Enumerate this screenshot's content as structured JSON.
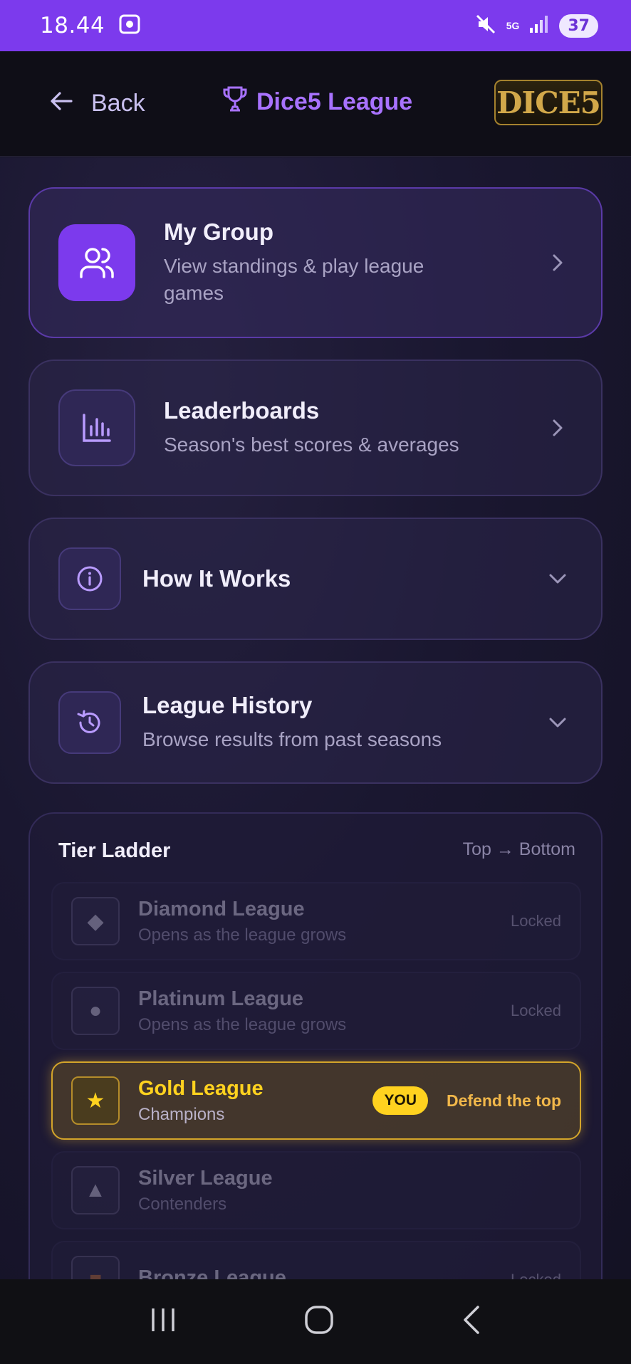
{
  "status_bar": {
    "time": "18.44",
    "network": "5G",
    "battery": "37",
    "icons": [
      "screenshot-icon",
      "mute-icon",
      "signal-icon"
    ]
  },
  "header": {
    "back_label": "Back",
    "title": "Dice5 League",
    "logo_text": "DICE5"
  },
  "menu": {
    "my_group": {
      "title": "My Group",
      "subtitle": "View standings & play league games"
    },
    "leaderboards": {
      "title": "Leaderboards",
      "subtitle": "Season's best scores & averages"
    },
    "how_it_works": {
      "title": "How It Works"
    },
    "league_history": {
      "title": "League History",
      "subtitle": "Browse results from past seasons"
    }
  },
  "tier_ladder": {
    "title": "Tier Ladder",
    "order_label": "Top → Bottom",
    "tiers": [
      {
        "name": "Diamond League",
        "desc": "Opens as the league grows",
        "status": "Locked",
        "icon": "◆"
      },
      {
        "name": "Platinum League",
        "desc": "Opens as the league grows",
        "status": "Locked",
        "icon": "●"
      },
      {
        "name": "Gold League",
        "desc": "Champions",
        "status": "Defend the top",
        "badge": "YOU",
        "icon": "★"
      },
      {
        "name": "Silver League",
        "desc": "Contenders",
        "status": "",
        "icon": "▲"
      },
      {
        "name": "Bronze League",
        "desc": "",
        "status": "Locked",
        "icon": "■"
      }
    ]
  },
  "colors": {
    "accent": "#7c3aed",
    "gold": "#ffd21f",
    "background": "#161424"
  }
}
